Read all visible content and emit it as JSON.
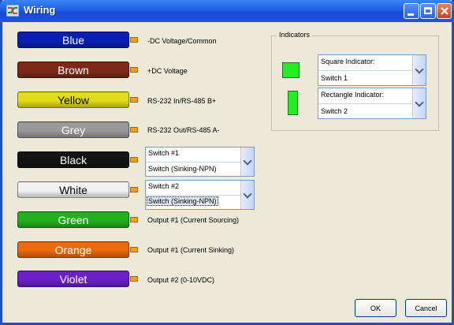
{
  "window": {
    "title": "Wiring"
  },
  "wires": [
    {
      "label": "Blue",
      "color": "#0a1fb4",
      "text_color": "#ffffff",
      "desc": "-DC Voltage/Common"
    },
    {
      "label": "Brown",
      "color": "#7c2a18",
      "text_color": "#ffffff",
      "desc": "+DC Voltage"
    },
    {
      "label": "Yellow",
      "color": "#e2dc18",
      "text_color": "#000000",
      "desc": "RS-232  In/RS-485 B+"
    },
    {
      "label": "Grey",
      "color": "#9a9a9a",
      "text_color": "#ffffff",
      "desc": "RS-232 Out/RS-485 A-"
    },
    {
      "label": "Black",
      "color": "#141414",
      "text_color": "#ffffff",
      "desc": ""
    },
    {
      "label": "White",
      "color": "#f2f2f2",
      "text_color": "#000000",
      "desc": ""
    },
    {
      "label": "Green",
      "color": "#23b01f",
      "text_color": "#ffffff",
      "desc": "Output #1 (Current Sourcing)"
    },
    {
      "label": "Orange",
      "color": "#ea6a0c",
      "text_color": "#ffffff",
      "desc": "Output #1 (Current Sinking)"
    },
    {
      "label": "Violet",
      "color": "#6c20c8",
      "text_color": "#ffffff",
      "desc": "Output #2 (0-10VDC)"
    }
  ],
  "black_combo": {
    "title": "Switch #1",
    "value": "Switch (Sinking-NPN)"
  },
  "white_combo": {
    "title": "Switch #2",
    "value": "Switch (Sinking-NPN)"
  },
  "indicators": {
    "group_label": "Indicators",
    "indicator_color": "#22ee22",
    "square": {
      "title": "Square Indicator:",
      "value": "Switch 1"
    },
    "rectangle": {
      "title": "Rectangle Indicator:",
      "value": "Switch 2"
    }
  },
  "buttons": {
    "ok": "OK",
    "cancel": "Cancel"
  }
}
